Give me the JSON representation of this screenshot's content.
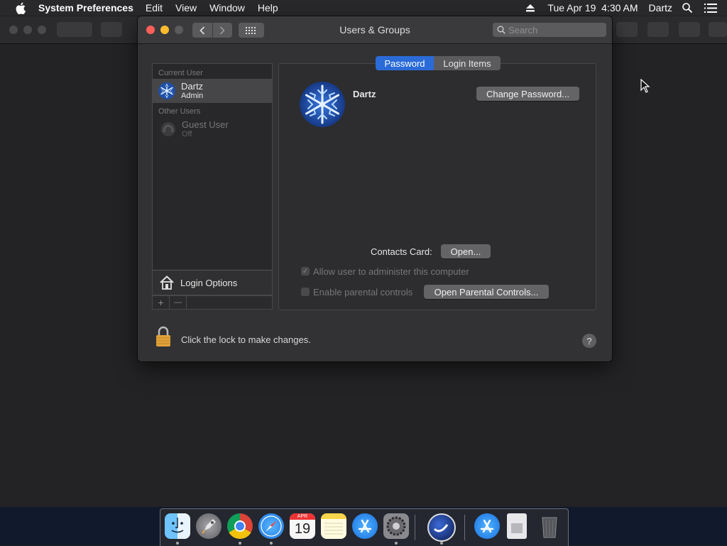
{
  "menubar": {
    "app_name": "System Preferences",
    "items": [
      "Edit",
      "View",
      "Window",
      "Help"
    ],
    "date_time": "Tue Apr 19  4:30 AM",
    "user": "Dartz",
    "icons": [
      "apple-icon",
      "eject-icon",
      "spotlight-icon",
      "notification-center-icon"
    ]
  },
  "window": {
    "title": "Users & Groups",
    "search_placeholder": "Search"
  },
  "sidebar": {
    "current_user_header": "Current User",
    "current_user": {
      "name": "Dartz",
      "role": "Admin"
    },
    "other_users_header": "Other Users",
    "other_users": [
      {
        "name": "Guest User",
        "status": "Off"
      }
    ],
    "login_options": "Login Options",
    "add_symbol": "+",
    "remove_symbol": "—"
  },
  "tabs": {
    "password": "Password",
    "login_items": "Login Items",
    "selected": "password"
  },
  "detail": {
    "user_name": "Dartz",
    "change_password": "Change Password...",
    "contacts_card_label": "Contacts Card:",
    "contacts_open": "Open...",
    "allow_admin_label": "Allow user to administer this computer",
    "allow_admin_checked": true,
    "parental_label": "Enable parental controls",
    "parental_checked": false,
    "open_parental": "Open Parental Controls..."
  },
  "footer": {
    "lock_text": "Click the lock to make changes.",
    "help_symbol": "?"
  },
  "calendar_icon": {
    "month": "APR",
    "day": "19"
  },
  "dock": {
    "apps": [
      "finder-icon",
      "launchpad-icon",
      "chrome-icon",
      "safari-icon",
      "calendar-icon",
      "notes-icon",
      "app-store-icon",
      "system-preferences-icon",
      "cinema4d-icon",
      "applications-folder-icon",
      "downloads-icon",
      "trash-icon"
    ]
  },
  "colors": {
    "accent": "#2a6bd8",
    "window_bg": "#323234",
    "lock": "#e0a23a"
  }
}
